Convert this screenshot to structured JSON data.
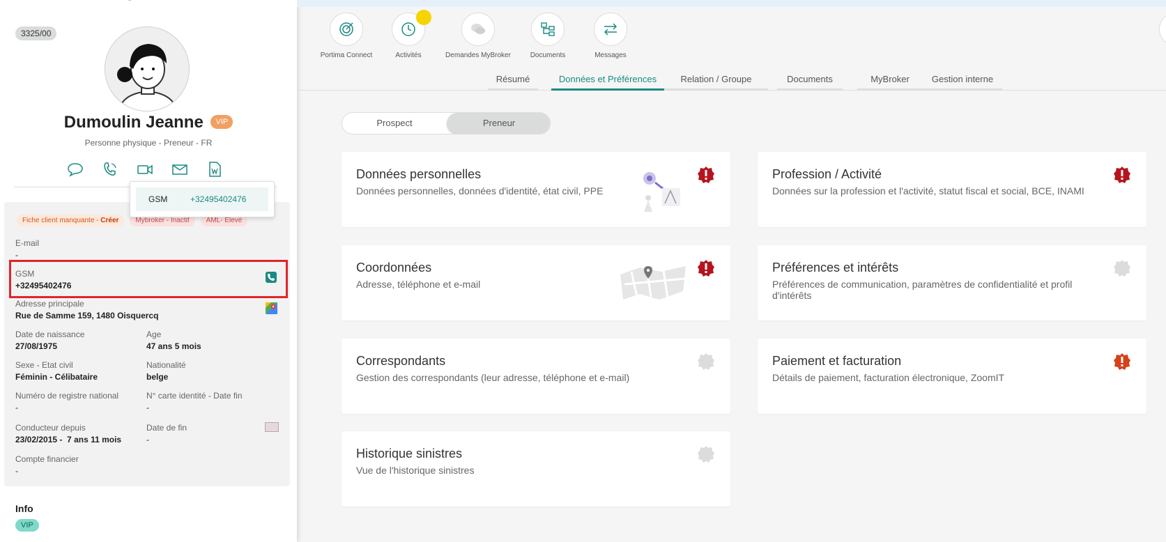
{
  "sidebar": {
    "client_id": "3325/00",
    "name": "Dumoulin Jeanne",
    "vip_badge": "VIP",
    "subtitle": "Personne physique - Preneur - FR",
    "tags": {
      "fiche_prefix": "Fiche client manquante - ",
      "fiche_action": "Créer",
      "mybroker": "Mybroker - Inactif",
      "aml": "AML- Elevé"
    },
    "fields": {
      "email_label": "E-mail",
      "email_value": "-",
      "gsm_label": "GSM",
      "gsm_value": "+32495402476",
      "address_label": "Adresse principale",
      "address_value": "Rue de Samme 159, 1480 Oisquercq",
      "dob_label": "Date de naissance",
      "dob_value": "27/08/1975",
      "age_label": "Age",
      "age_value": "47 ans 5 mois",
      "sex_label": "Sexe - Etat civil",
      "sex_value": "Féminin - Célibataire",
      "nationality_label": "Nationalité",
      "nationality_value": "belge",
      "nrn_label": "Numéro de registre national",
      "nrn_value": "-",
      "idcard_label": "N° carte identité - Date fin",
      "idcard_value": "-",
      "driver_label": "Conducteur depuis",
      "driver_value": "23/02/2015 -  7 ans 11 mois",
      "enddate_label": "Date de fin",
      "enddate_value": "-",
      "account_label": "Compte financier",
      "account_value": "-"
    },
    "info_title": "Info",
    "info_vip": "VIP",
    "popup": {
      "label": "GSM",
      "value": "+32495402476"
    }
  },
  "quick_actions": [
    {
      "label": "Portima Connect",
      "icon": "target-icon"
    },
    {
      "label": "Activités",
      "icon": "clock-icon"
    },
    {
      "label": "Demandes MyBroker",
      "icon": "chat-icon"
    },
    {
      "label": "Documents",
      "icon": "tree-icon"
    },
    {
      "label": "Messages",
      "icon": "arrows-icon"
    }
  ],
  "tabs": [
    {
      "label": "Résumé"
    },
    {
      "label": "Données et Préférences"
    },
    {
      "label": "Relation / Groupe"
    },
    {
      "label": "Documents"
    },
    {
      "label": "MyBroker"
    },
    {
      "label": "Gestion interne"
    }
  ],
  "toggle": {
    "prospect": "Prospect",
    "preneur": "Preneur"
  },
  "cards": [
    {
      "title": "Données personnelles",
      "desc": "Données personnelles, données d'identité, état civil, PPE",
      "status": "alert"
    },
    {
      "title": "Profession / Activité",
      "desc": "Données sur la profession et l'activité, statut fiscal et social, BCE, INAMI",
      "status": "alert"
    },
    {
      "title": "Coordonnées",
      "desc": "Adresse, téléphone et e-mail",
      "status": "alert"
    },
    {
      "title": "Préférences et intérêts",
      "desc": "Préférences de communication, paramètres de confidentialité et profil d'intérêts",
      "status": "none"
    },
    {
      "title": "Correspondants",
      "desc": "Gestion des correspondants (leur adresse, téléphone et e-mail)",
      "status": "none"
    },
    {
      "title": "Paiement et facturation",
      "desc": "Détails de paiement, facturation électronique, ZoomIT",
      "status": "warning"
    },
    {
      "title": "Historique sinistres",
      "desc": "Vue de l'historique sinistres",
      "status": "none"
    }
  ],
  "colors": {
    "accent": "#1a8a82",
    "alert": "#b5141e",
    "warning": "#d6411b",
    "inactive": "#dcdcdc"
  }
}
